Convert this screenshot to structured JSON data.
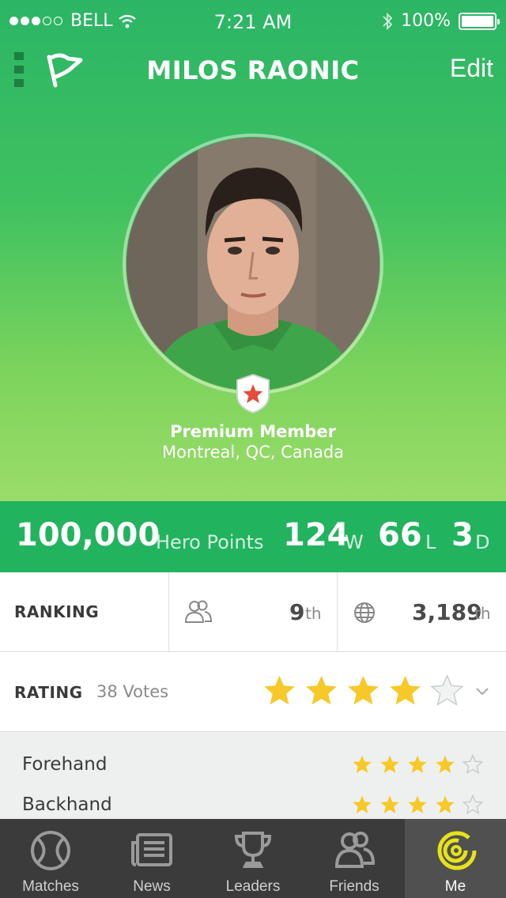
{
  "status_bar": {
    "carrier": "BELL",
    "time": "7:21 AM",
    "battery": "100%",
    "signal_filled": 3,
    "signal_total": 5,
    "battery_level": 1.0
  },
  "header": {
    "title": "MILOS RAONIC",
    "edit_label": "Edit"
  },
  "profile": {
    "member_type": "Premium Member",
    "location": "Montreal, QC, Canada"
  },
  "stats": {
    "points": "100,000",
    "points_label": "Hero Points",
    "wins": "124",
    "wins_unit": "W",
    "losses": "66",
    "losses_unit": "L",
    "draws": "3",
    "draws_unit": "D"
  },
  "ranking": {
    "label": "RANKING",
    "friends_rank": "9",
    "friends_suffix": "th",
    "global_rank": "3,189",
    "global_suffix": "th"
  },
  "rating": {
    "label": "RATING",
    "votes": "38 Votes",
    "stars": 4,
    "max_stars": 5
  },
  "sub_ratings": [
    {
      "label": "Forehand",
      "stars": 4
    },
    {
      "label": "Backhand",
      "stars": 4
    }
  ],
  "colors": {
    "accent_green": "#22b35e",
    "star_yellow": "#f7c928",
    "ring_yellow": "#e6e21a"
  },
  "tabs": [
    {
      "label": "Matches",
      "icon": "tennis-ball-icon"
    },
    {
      "label": "News",
      "icon": "newspaper-icon"
    },
    {
      "label": "Leaders",
      "icon": "trophy-icon"
    },
    {
      "label": "Friends",
      "icon": "friends-icon"
    },
    {
      "label": "Me",
      "icon": "target-ring-icon",
      "active": true
    }
  ]
}
